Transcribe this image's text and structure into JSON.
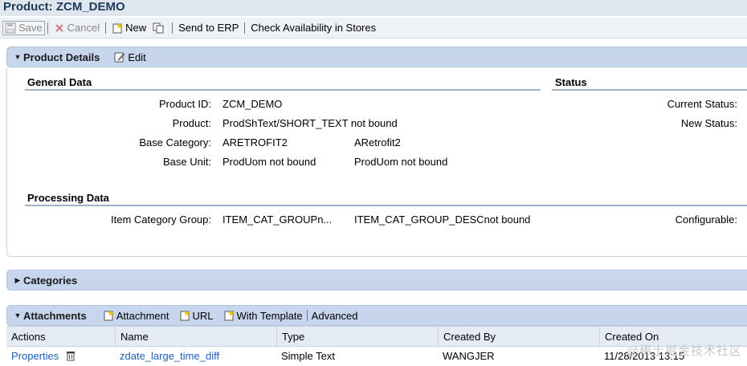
{
  "page_title": "Product: ZCM_DEMO",
  "toolbar": {
    "save": "Save",
    "cancel": "Cancel",
    "new": "New",
    "send_erp": "Send to ERP",
    "check_avail": "Check Availability in Stores"
  },
  "product_details": {
    "title": "Product Details",
    "edit": "Edit",
    "general_data": {
      "heading": "General Data",
      "product_id_label": "Product ID:",
      "product_id_value": "ZCM_DEMO",
      "product_label": "Product:",
      "product_value": "ProdShText/SHORT_TEXT not bound",
      "base_category_label": "Base Category:",
      "base_category_value": "ARETROFIT2",
      "base_category_desc": "ARetrofit2",
      "base_unit_label": "Base Unit:",
      "base_unit_value": "ProdUom not bound",
      "base_unit_desc": "ProdUom not bound"
    },
    "status": {
      "heading": "Status",
      "current_status_label": "Current Status:",
      "new_status_label": "New Status:"
    },
    "processing_data": {
      "heading": "Processing Data",
      "item_cat_group_label": "Item Category Group:",
      "item_cat_group_value": "ITEM_CAT_GROUPn...",
      "item_cat_group_desc": "ITEM_CAT_GROUP_DESCnot bound",
      "configurable_label": "Configurable:"
    }
  },
  "categories": {
    "title": "Categories"
  },
  "attachments": {
    "title": "Attachments",
    "actions": {
      "attachment": "Attachment",
      "url": "URL",
      "with_template": "With Template",
      "advanced": "Advanced"
    },
    "columns": [
      "Actions",
      "Name",
      "Type",
      "Created By",
      "Created On"
    ],
    "rows": [
      {
        "action": "Properties",
        "name": "zdate_large_time_diff",
        "type": "Simple Text",
        "created_by": "WANGJER",
        "created_on": "11/28/2013 13:15"
      }
    ]
  },
  "watermark": "@稀土掘金技术社区"
}
